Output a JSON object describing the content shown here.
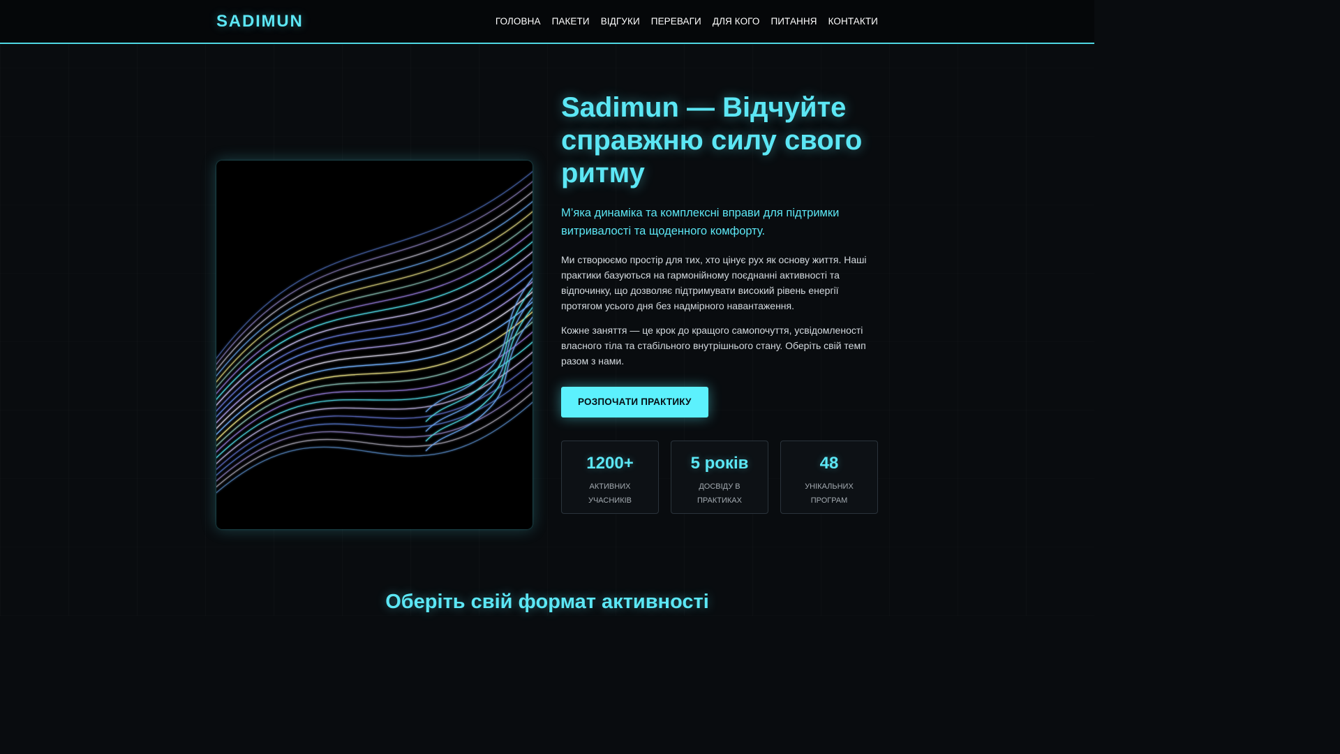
{
  "brand": {
    "logo": "SADIMUN"
  },
  "nav": {
    "items": [
      "ГОЛОВНА",
      "ПАКЕТИ",
      "ВІДГУКИ",
      "ПЕРЕВАГИ",
      "ДЛЯ КОГО",
      "ПИТАННЯ",
      "КОНТАКТИ"
    ]
  },
  "hero": {
    "title": "Sadimun — Відчуйте справжню силу свого ритму",
    "subtitle": "М’яка динаміка та комплексні вправи для підтримки витривалості та щоденного комфорту.",
    "paragraphs": [
      "Ми створюємо простір для тих, хто цінує рух як основу життя. Наші практики базуються на гармонійному поєднанні активності та відпочинку, що дозволяє підтримувати високий рівень енергії протягом усього дня без надмірного навантаження.",
      "Кожне заняття — це крок до кращого самопочуття, усвідомленості власного тіла та стабільного внутрішнього стану. Оберіть свій темп разом з нами."
    ],
    "cta_label": "РОЗПОЧАТИ ПРАКТИКУ",
    "artwork_icon": "light-waves-art"
  },
  "stats": [
    {
      "value": "1200+",
      "label": "АКТИВНИХ УЧАСНИКІВ"
    },
    {
      "value": "5 років",
      "label": "ДОСВІДУ В ПРАКТИКАХ"
    },
    {
      "value": "48",
      "label": "УНІКАЛЬНИХ ПРОГРАМ"
    }
  ],
  "next_section": {
    "title": "Оберіть свій формат активності"
  },
  "colors": {
    "accent": "#5ce7f5",
    "background": "#090c0f",
    "button": "#5cf1fd"
  }
}
